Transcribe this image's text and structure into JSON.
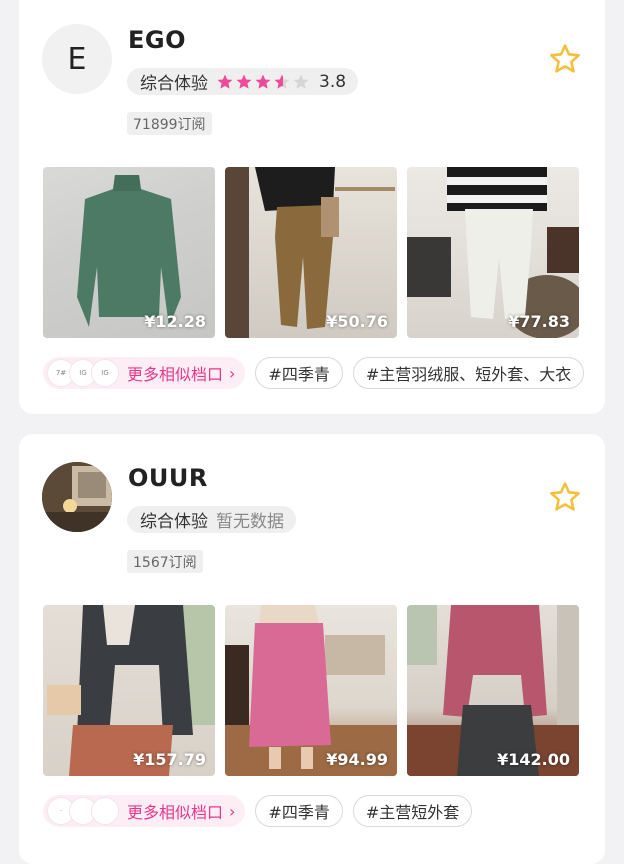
{
  "shops": [
    {
      "avatar_letter": "E",
      "name": "EGO",
      "rating_label": "综合体验",
      "rating_score": "3.8",
      "rating_value": 3.8,
      "subscribers": "71899订阅",
      "products": [
        {
          "price": "¥12.28"
        },
        {
          "price": "¥50.76"
        },
        {
          "price": "¥77.83"
        }
      ],
      "more_similar": "更多相似档口",
      "tags": [
        "#四季青",
        "#主营羽绒服、短外套、大衣"
      ]
    },
    {
      "name": "OUUR",
      "rating_label": "综合体验",
      "rating_none": "暂无数据",
      "subscribers": "1567订阅",
      "products": [
        {
          "price": "¥157.79"
        },
        {
          "price": "¥94.99"
        },
        {
          "price": "¥142.00"
        }
      ],
      "more_similar": "更多相似档口",
      "tags": [
        "#四季青",
        "#主营短外套"
      ]
    }
  ],
  "colors": {
    "accent_pink": "#e8378a",
    "star_pink": "#f24a9a",
    "favorite_star": "#f4bf3a"
  }
}
